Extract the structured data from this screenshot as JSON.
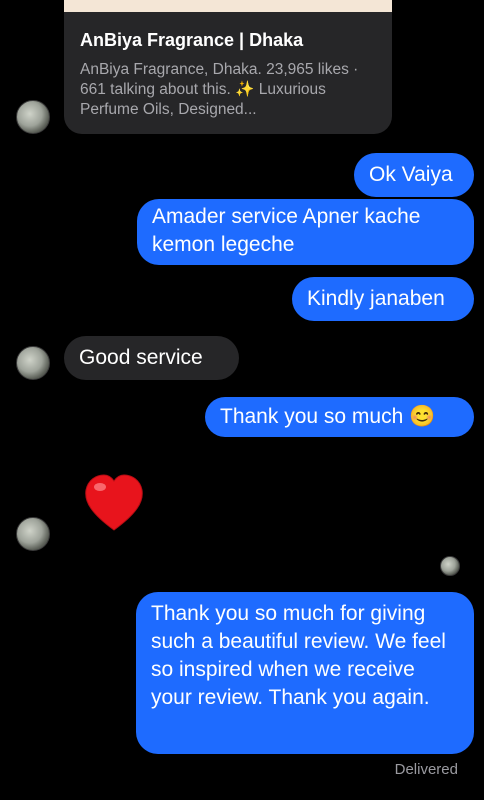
{
  "link_preview": {
    "title": "AnBiya Fragrance | Dhaka",
    "description": "AnBiya Fragrance, Dhaka. 23,965 likes · 661 talking about this. ✨ Luxurious Perfume Oils, Designed..."
  },
  "messages": [
    {
      "side": "out",
      "text": "Ok Vaiya"
    },
    {
      "side": "out",
      "text": "Amader service Apner kache kemon legeche"
    },
    {
      "side": "out",
      "text": "Kindly janaben"
    },
    {
      "side": "in",
      "text": "Good service"
    },
    {
      "side": "out",
      "text": "Thank you so much 😊"
    },
    {
      "side": "in",
      "text": "❤️",
      "kind": "emoji"
    },
    {
      "side": "out",
      "text": "Thank you so much for giving such a beautiful review. We feel so inspired when we receive your review. Thank you again."
    }
  ],
  "status": "Delivered",
  "colors": {
    "outgoing": "#1e6bff",
    "incoming": "#262628",
    "background": "#000000"
  }
}
